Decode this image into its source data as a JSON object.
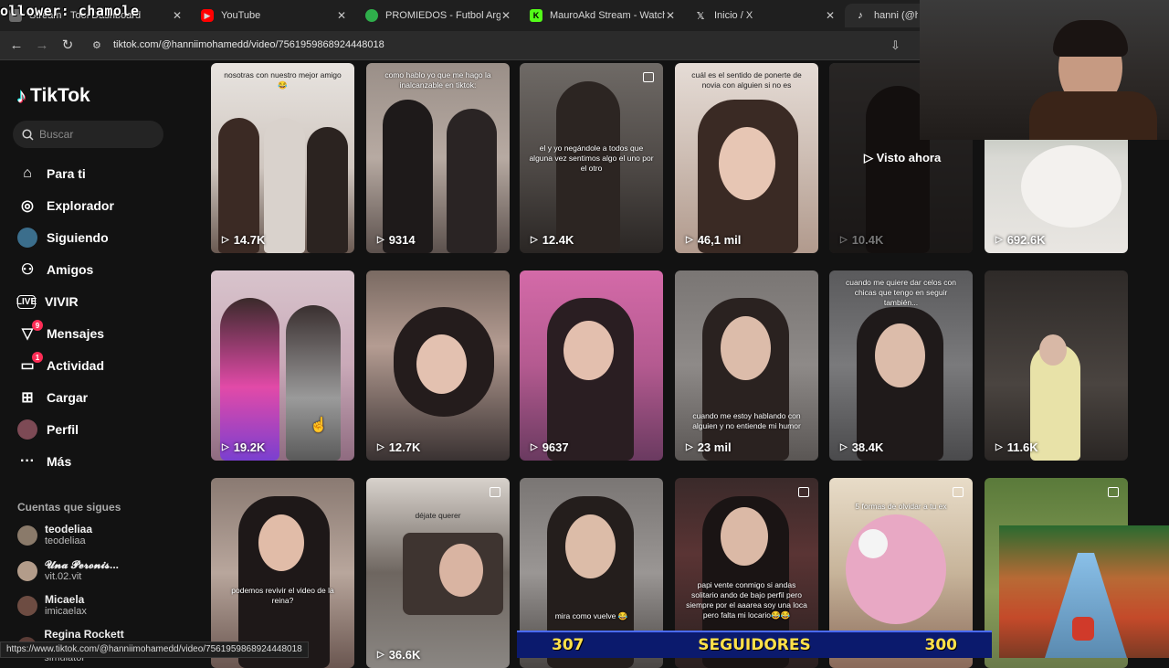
{
  "browser": {
    "stream_overlay_text": "ollower: chamole",
    "tabs": [
      {
        "label": "Stream - Tool Dashboard",
        "icon": "dashboard-icon",
        "color": "#6b6b6b"
      },
      {
        "label": "YouTube",
        "icon": "youtube-icon",
        "color": "#ff0000"
      },
      {
        "label": "PROMIEDOS - Futbol Argent",
        "icon": "promiedos-icon",
        "color": "#2fae4b"
      },
      {
        "label": "MauroAkd Stream - Watch",
        "icon": "kick-icon",
        "color": "#53fc18"
      },
      {
        "label": "Inicio / X",
        "icon": "x-icon",
        "color": "#000000"
      },
      {
        "label": "hanni (@hanni",
        "icon": "tiktok-icon",
        "color": "#000000"
      }
    ],
    "url": "tiktok.com/@hanniimohamedd/video/7561959868924448018",
    "status_url": "https://www.tiktok.com/@hanniimohamedd/video/7561959868924448018"
  },
  "sidebar": {
    "logo": "TikTok",
    "search_placeholder": "Buscar",
    "nav": [
      {
        "label": "Para ti",
        "icon": "home-icon"
      },
      {
        "label": "Explorador",
        "icon": "compass-icon"
      },
      {
        "label": "Siguiendo",
        "icon": "following-avatar-icon"
      },
      {
        "label": "Amigos",
        "icon": "friends-icon"
      },
      {
        "label": "VIVIR",
        "icon": "live-icon"
      },
      {
        "label": "Mensajes",
        "icon": "messages-icon",
        "badge": "9"
      },
      {
        "label": "Actividad",
        "icon": "activity-icon",
        "badge": "1"
      },
      {
        "label": "Cargar",
        "icon": "upload-icon"
      },
      {
        "label": "Perfil",
        "icon": "profile-avatar-icon"
      },
      {
        "label": "Más",
        "icon": "more-icon"
      }
    ],
    "following_title": "Cuentas que sigues",
    "following": [
      {
        "name": "teodeliaa",
        "username": "teodeliaa"
      },
      {
        "name": "𝓤𝓷𝓪 𝓟𝓮𝓻𝓸𝓷𝓲𝓼...",
        "username": "vit.02.vit"
      },
      {
        "name": "Micaela",
        "username": "imicaelax"
      },
      {
        "name": "Regina Rockett",
        "username": "thiagocarbonero: tirar cv simulator"
      }
    ]
  },
  "grid": {
    "watched_label": "Visto ahora",
    "videos": [
      {
        "caption": "nosotras con nuestro mejor amigo 😂",
        "views": "14.7K"
      },
      {
        "caption": "como hablo yo que me hago la inalcanzable en tiktok:",
        "views": "9314"
      },
      {
        "caption": "el y yo negándole a todos que alguna vez sentimos algo el uno por el otro",
        "views": "12.4K",
        "multi": true
      },
      {
        "caption": "cuál es el sentido de ponerte de novia con alguien si no es",
        "views": "46,1 mil"
      },
      {
        "caption": "",
        "views": "10.4K"
      },
      {
        "caption": "",
        "views": "692.6K"
      },
      {
        "caption": "",
        "views": "19.2K"
      },
      {
        "caption": "",
        "views": "12.7K"
      },
      {
        "caption": "",
        "views": "9637"
      },
      {
        "caption": "cuando me estoy hablando con alguien y no entiende mi humor",
        "views": "23 mil"
      },
      {
        "caption": "cuando me quiere dar celos con chicas que tengo en seguir también...",
        "views": "38.4K"
      },
      {
        "caption": "",
        "views": "11.6K"
      },
      {
        "caption": "podemos revivir el video de la reina?",
        "views": ""
      },
      {
        "caption": "déjate querer",
        "views": "36.6K",
        "multi": true
      },
      {
        "caption": "mira como vuelve 😂",
        "views": ""
      },
      {
        "caption": "papi vente conmigo si andas solitario ando de bajo perfil pero siempre por el aaarea soy una loca pero falta mi locario😂😂",
        "views": "",
        "multi": true
      },
      {
        "caption": "5 formas de olvidar a tu ex",
        "views": "",
        "multi": true
      },
      {
        "caption": "",
        "views": "",
        "multi": true
      }
    ]
  },
  "stream_bar": {
    "left": "307",
    "label": "SEGUIDORES",
    "right": "300"
  }
}
